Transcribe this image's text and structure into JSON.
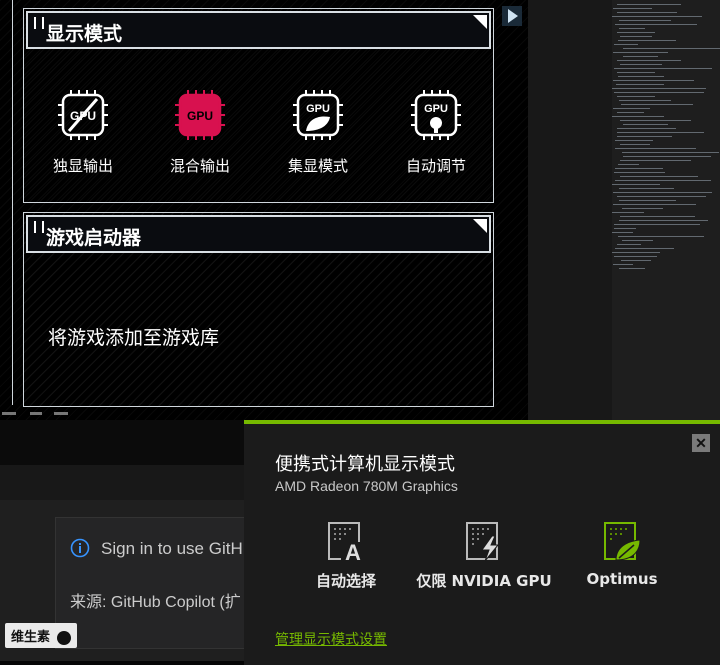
{
  "armoury": {
    "display_mode_title": "显示模式",
    "modes": [
      {
        "label": "独显输出",
        "icon": "gpu-ultimate-icon"
      },
      {
        "label": "混合输出",
        "icon": "gpu-standard-icon",
        "active": true
      },
      {
        "label": "集显模式",
        "icon": "gpu-eco-icon"
      },
      {
        "label": "自动调节",
        "icon": "gpu-optimized-icon"
      }
    ],
    "chip_text": "GPU",
    "launcher_title": "游戏启动器",
    "add_games_text": "将游戏添加至游戏库",
    "active_color": "#d8114f"
  },
  "vscode": {
    "toast_text": "Sign in to use GitH",
    "source_text": "来源: GitHub Copilot (扩"
  },
  "nvidia": {
    "title": "便携式计算机显示模式",
    "subtitle": "AMD Radeon 780M Graphics",
    "options": [
      {
        "label": "自动选择",
        "icon": "auto-select-icon"
      },
      {
        "label": "仅限 NVIDIA GPU",
        "icon": "nvidia-only-icon"
      },
      {
        "label": "Optimus",
        "icon": "optimus-icon",
        "selected": true
      }
    ],
    "manage_link": "管理显示模式设置",
    "close_label": "✕",
    "accent": "#76b900"
  },
  "watermark": "维生素"
}
